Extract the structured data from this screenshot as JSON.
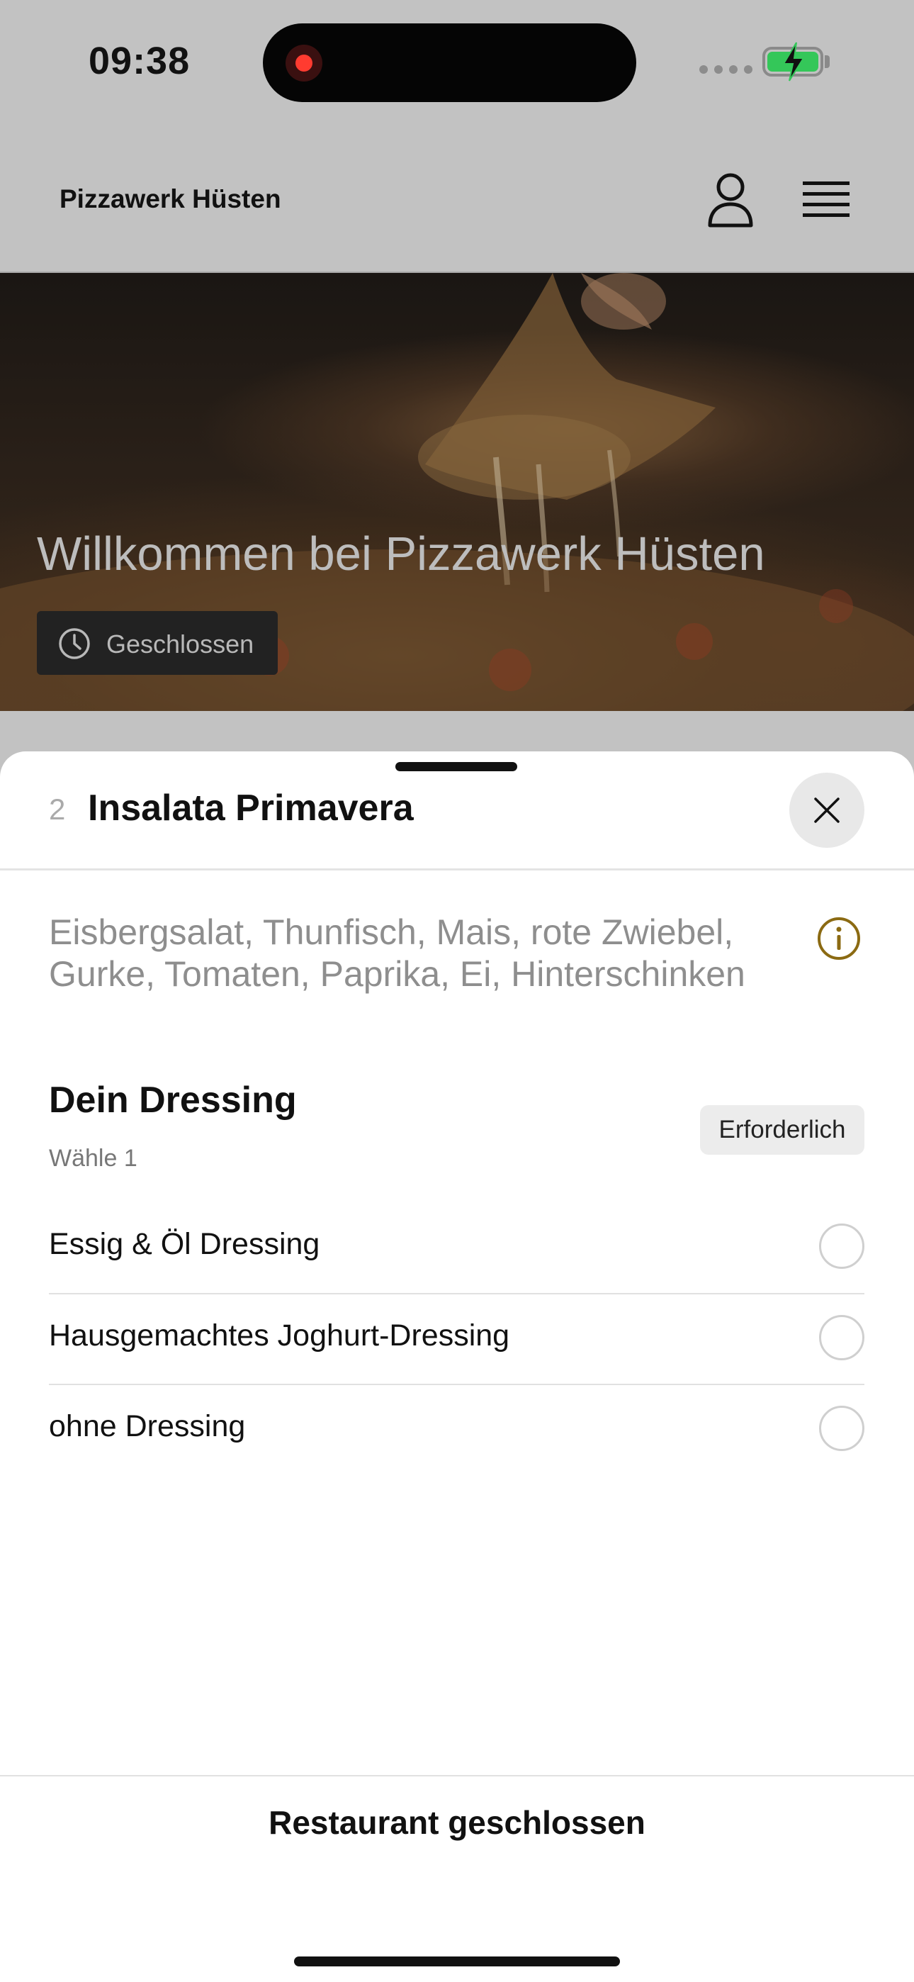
{
  "status_bar": {
    "time": "09:38",
    "icons": [
      "recording-indicator-icon",
      "cellular-signal-icon",
      "battery-charging-icon"
    ],
    "colors": {
      "recording": "#ff3b30",
      "battery": "#34c759"
    }
  },
  "header": {
    "title": "Pizzawerk Hüsten",
    "icons": [
      "user-icon",
      "hamburger-menu-icon"
    ]
  },
  "hero": {
    "title": "Willkommen bei Pizzawerk Hüsten",
    "status": "Geschlossen",
    "status_icon": "clock-icon"
  },
  "sheet": {
    "item_number": "2",
    "item_title": "Insalata Primavera",
    "close_icon": "close-icon",
    "description": "Eisbergsalat, Thunfisch, Mais, rote Zwiebel, Gurke, Tomaten, Paprika, Ei, Hinterschinken",
    "info_icon": "info-icon",
    "info_color": "#8b6a12",
    "section": {
      "title": "Dein Dressing",
      "subtitle": "Wähle 1",
      "badge": "Erforderlich",
      "options": [
        {
          "label": "Essig & Öl Dressing",
          "selected": false
        },
        {
          "label": "Hausgemachtes Joghurt-Dressing",
          "selected": false
        },
        {
          "label": "ohne Dressing",
          "selected": false
        }
      ]
    },
    "footer_button": "Restaurant geschlossen"
  }
}
